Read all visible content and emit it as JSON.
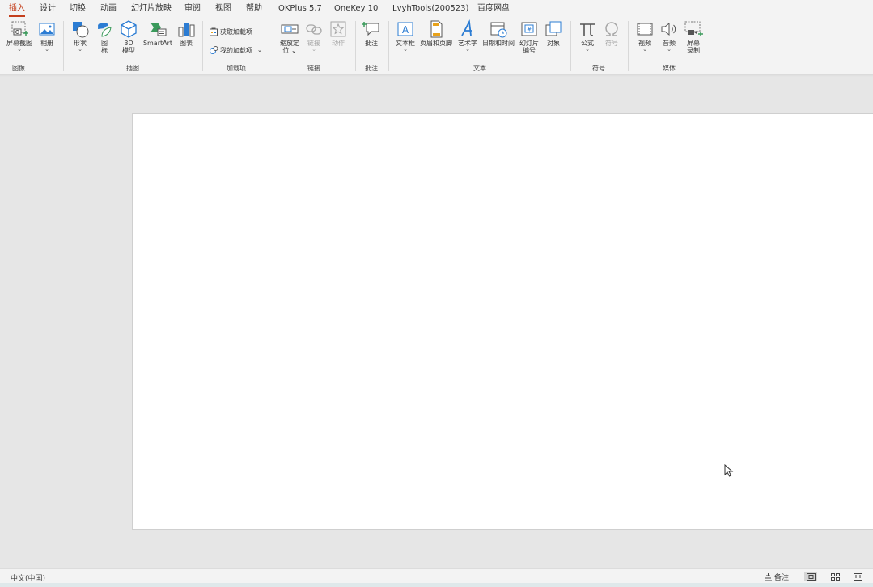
{
  "tabs": [
    "插入",
    "设计",
    "切换",
    "动画",
    "幻灯片放映",
    "审阅",
    "视图",
    "帮助",
    "OKPlus 5.7",
    "OneKey 10",
    "LvyhTools(200523)",
    "百度网盘"
  ],
  "active_tab": "插入",
  "ribbon": {
    "images": {
      "screenshot": "屏幕截图",
      "album": "相册",
      "group": "图像"
    },
    "illustrations": {
      "shapes": "形状",
      "icons_1": "图",
      "icons_2": "标",
      "model_1": "3D",
      "model_2": "模型",
      "smartart": "SmartArt",
      "chart": "图表",
      "group": "插图"
    },
    "addins": {
      "get": "获取加载项",
      "my": "我的加载项",
      "group": "加载项"
    },
    "links": {
      "zoom_1": "缩放定",
      "zoom_2": "位",
      "link": "链接",
      "action": "动作",
      "group": "链接"
    },
    "comments": {
      "comment": "批注",
      "group": "批注"
    },
    "text": {
      "textbox": "文本框",
      "header_footer": "页眉和页脚",
      "wordart": "艺术字",
      "datetime": "日期和时间",
      "slide_num_1": "幻灯片",
      "slide_num_2": "编号",
      "object": "对象",
      "group": "文本"
    },
    "symbols": {
      "equation": "公式",
      "symbol": "符号",
      "group": "符号"
    },
    "media": {
      "video": "视频",
      "audio": "音频",
      "rec_1": "屏幕",
      "rec_2": "录制",
      "group": "媒体"
    }
  },
  "status": {
    "language": "中文(中国)",
    "notes": "备注"
  },
  "colors": {
    "accent": "#c43e1c",
    "blue": "#2b7cd3",
    "green": "#3a9a5b"
  }
}
